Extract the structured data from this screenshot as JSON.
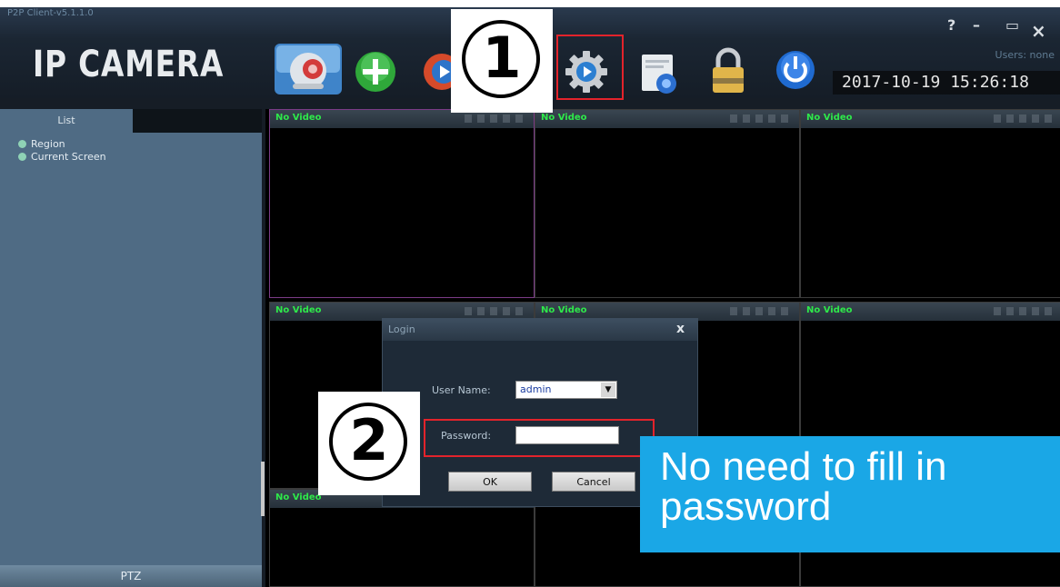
{
  "window": {
    "title": "P2P Client-v5.1.1.0",
    "brand": "IP CAMERA",
    "users_label": "Users: none",
    "datetime": "2017-10-19 15:26:18",
    "controls": {
      "help": "?",
      "minimize": "–",
      "maximize": "▭",
      "close": "×"
    }
  },
  "toolbar": {
    "icons": [
      "camera-icon",
      "add-device-icon",
      "playback-icon",
      "settings-gear-icon",
      "recording-file-icon",
      "lock-icon",
      "power-icon"
    ]
  },
  "sidebar": {
    "tab": "List",
    "items": [
      {
        "label": "Region"
      },
      {
        "label": "Current Screen"
      }
    ],
    "ptz_label": "PTZ"
  },
  "video_grid": {
    "cells": [
      {
        "label": "No Video"
      },
      {
        "label": "No Video"
      },
      {
        "label": "No Video"
      },
      {
        "label": "No Video"
      },
      {
        "label": "No Video"
      },
      {
        "label": "No Video"
      },
      {
        "label": "No Video"
      }
    ]
  },
  "login_dialog": {
    "title": "Login",
    "close": "x",
    "username_label": "User Name:",
    "username_value": "admin",
    "dropdown_arrow": "▼",
    "password_label": "Password:",
    "password_value": "",
    "ok_label": "OK",
    "cancel_label": "Cancel"
  },
  "annotations": {
    "step1": "1",
    "step2": "2",
    "callout_line1": "No need to fill in",
    "callout_line2": "password"
  },
  "colors": {
    "highlight": "#e3232b",
    "callout_bg": "#1aa7e6",
    "no_video_text": "#2ee84a",
    "panel_bg": "#4f6b84"
  }
}
